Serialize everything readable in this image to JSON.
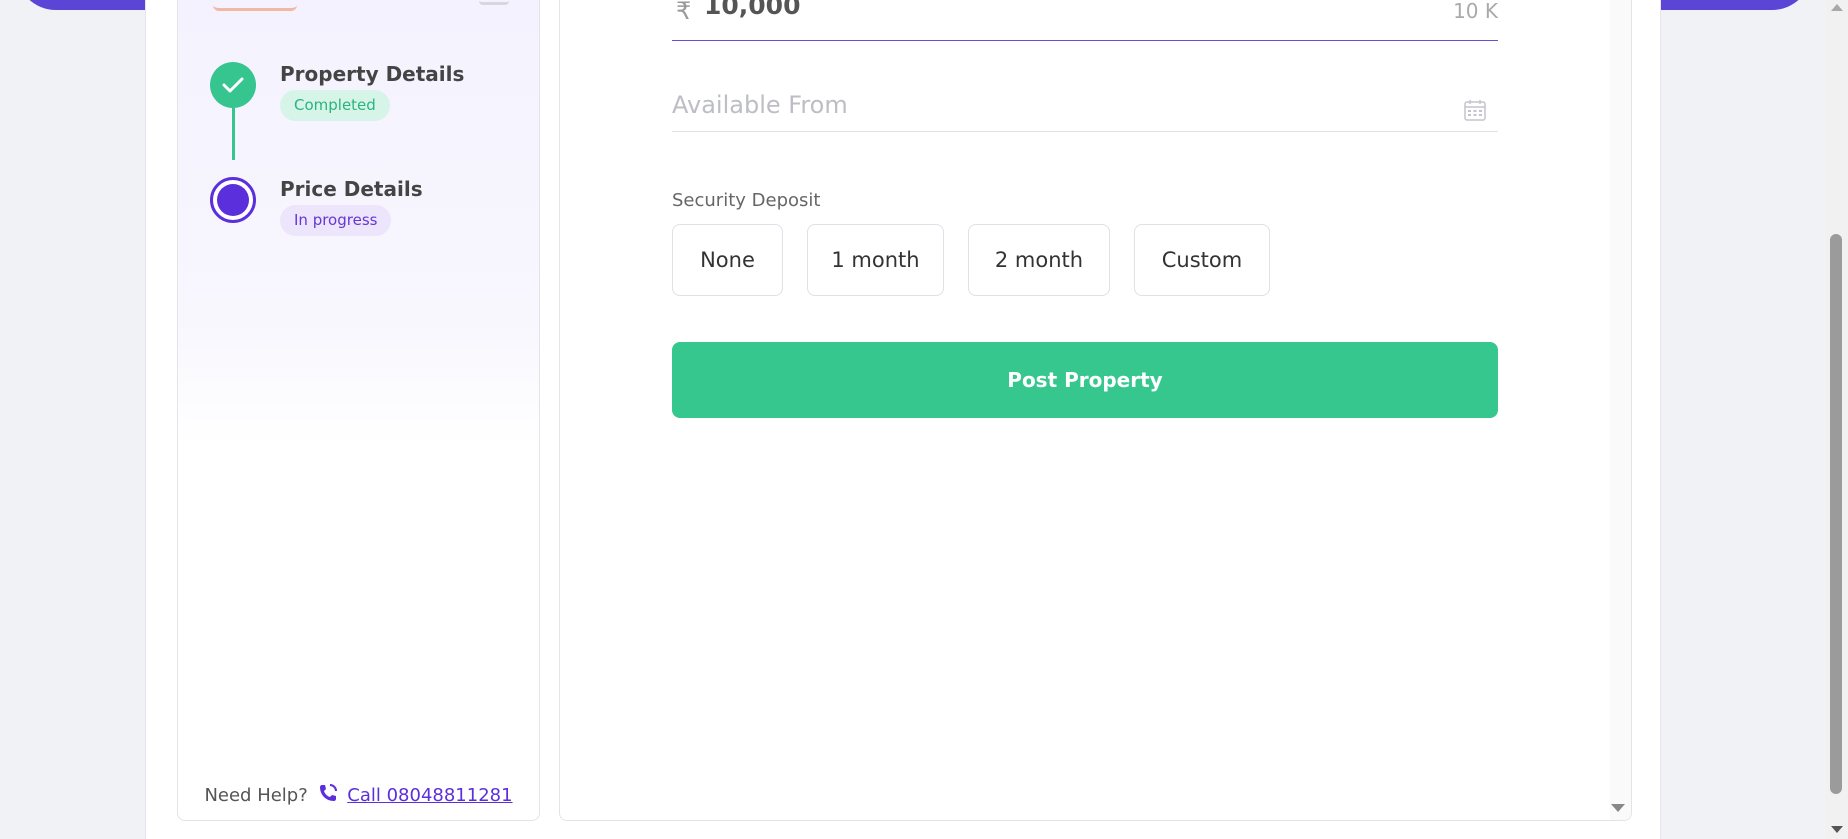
{
  "steps": [
    {
      "title": "Property Details",
      "status": "Completed"
    },
    {
      "title": "Price Details",
      "status": "In progress"
    }
  ],
  "help": {
    "label": "Need Help?",
    "call_text": "Call 08048811281"
  },
  "rent": {
    "currency_symbol": "₹",
    "value": "10,000",
    "words": "10 K"
  },
  "available_from": {
    "placeholder": "Available From"
  },
  "security_deposit": {
    "label": "Security Deposit",
    "options": [
      "None",
      "1 month",
      "2 month",
      "Custom"
    ]
  },
  "post_button": "Post Property",
  "colors": {
    "accent": "#5b2fdc",
    "success": "#36c78f",
    "topbar": "#5b45d6"
  }
}
